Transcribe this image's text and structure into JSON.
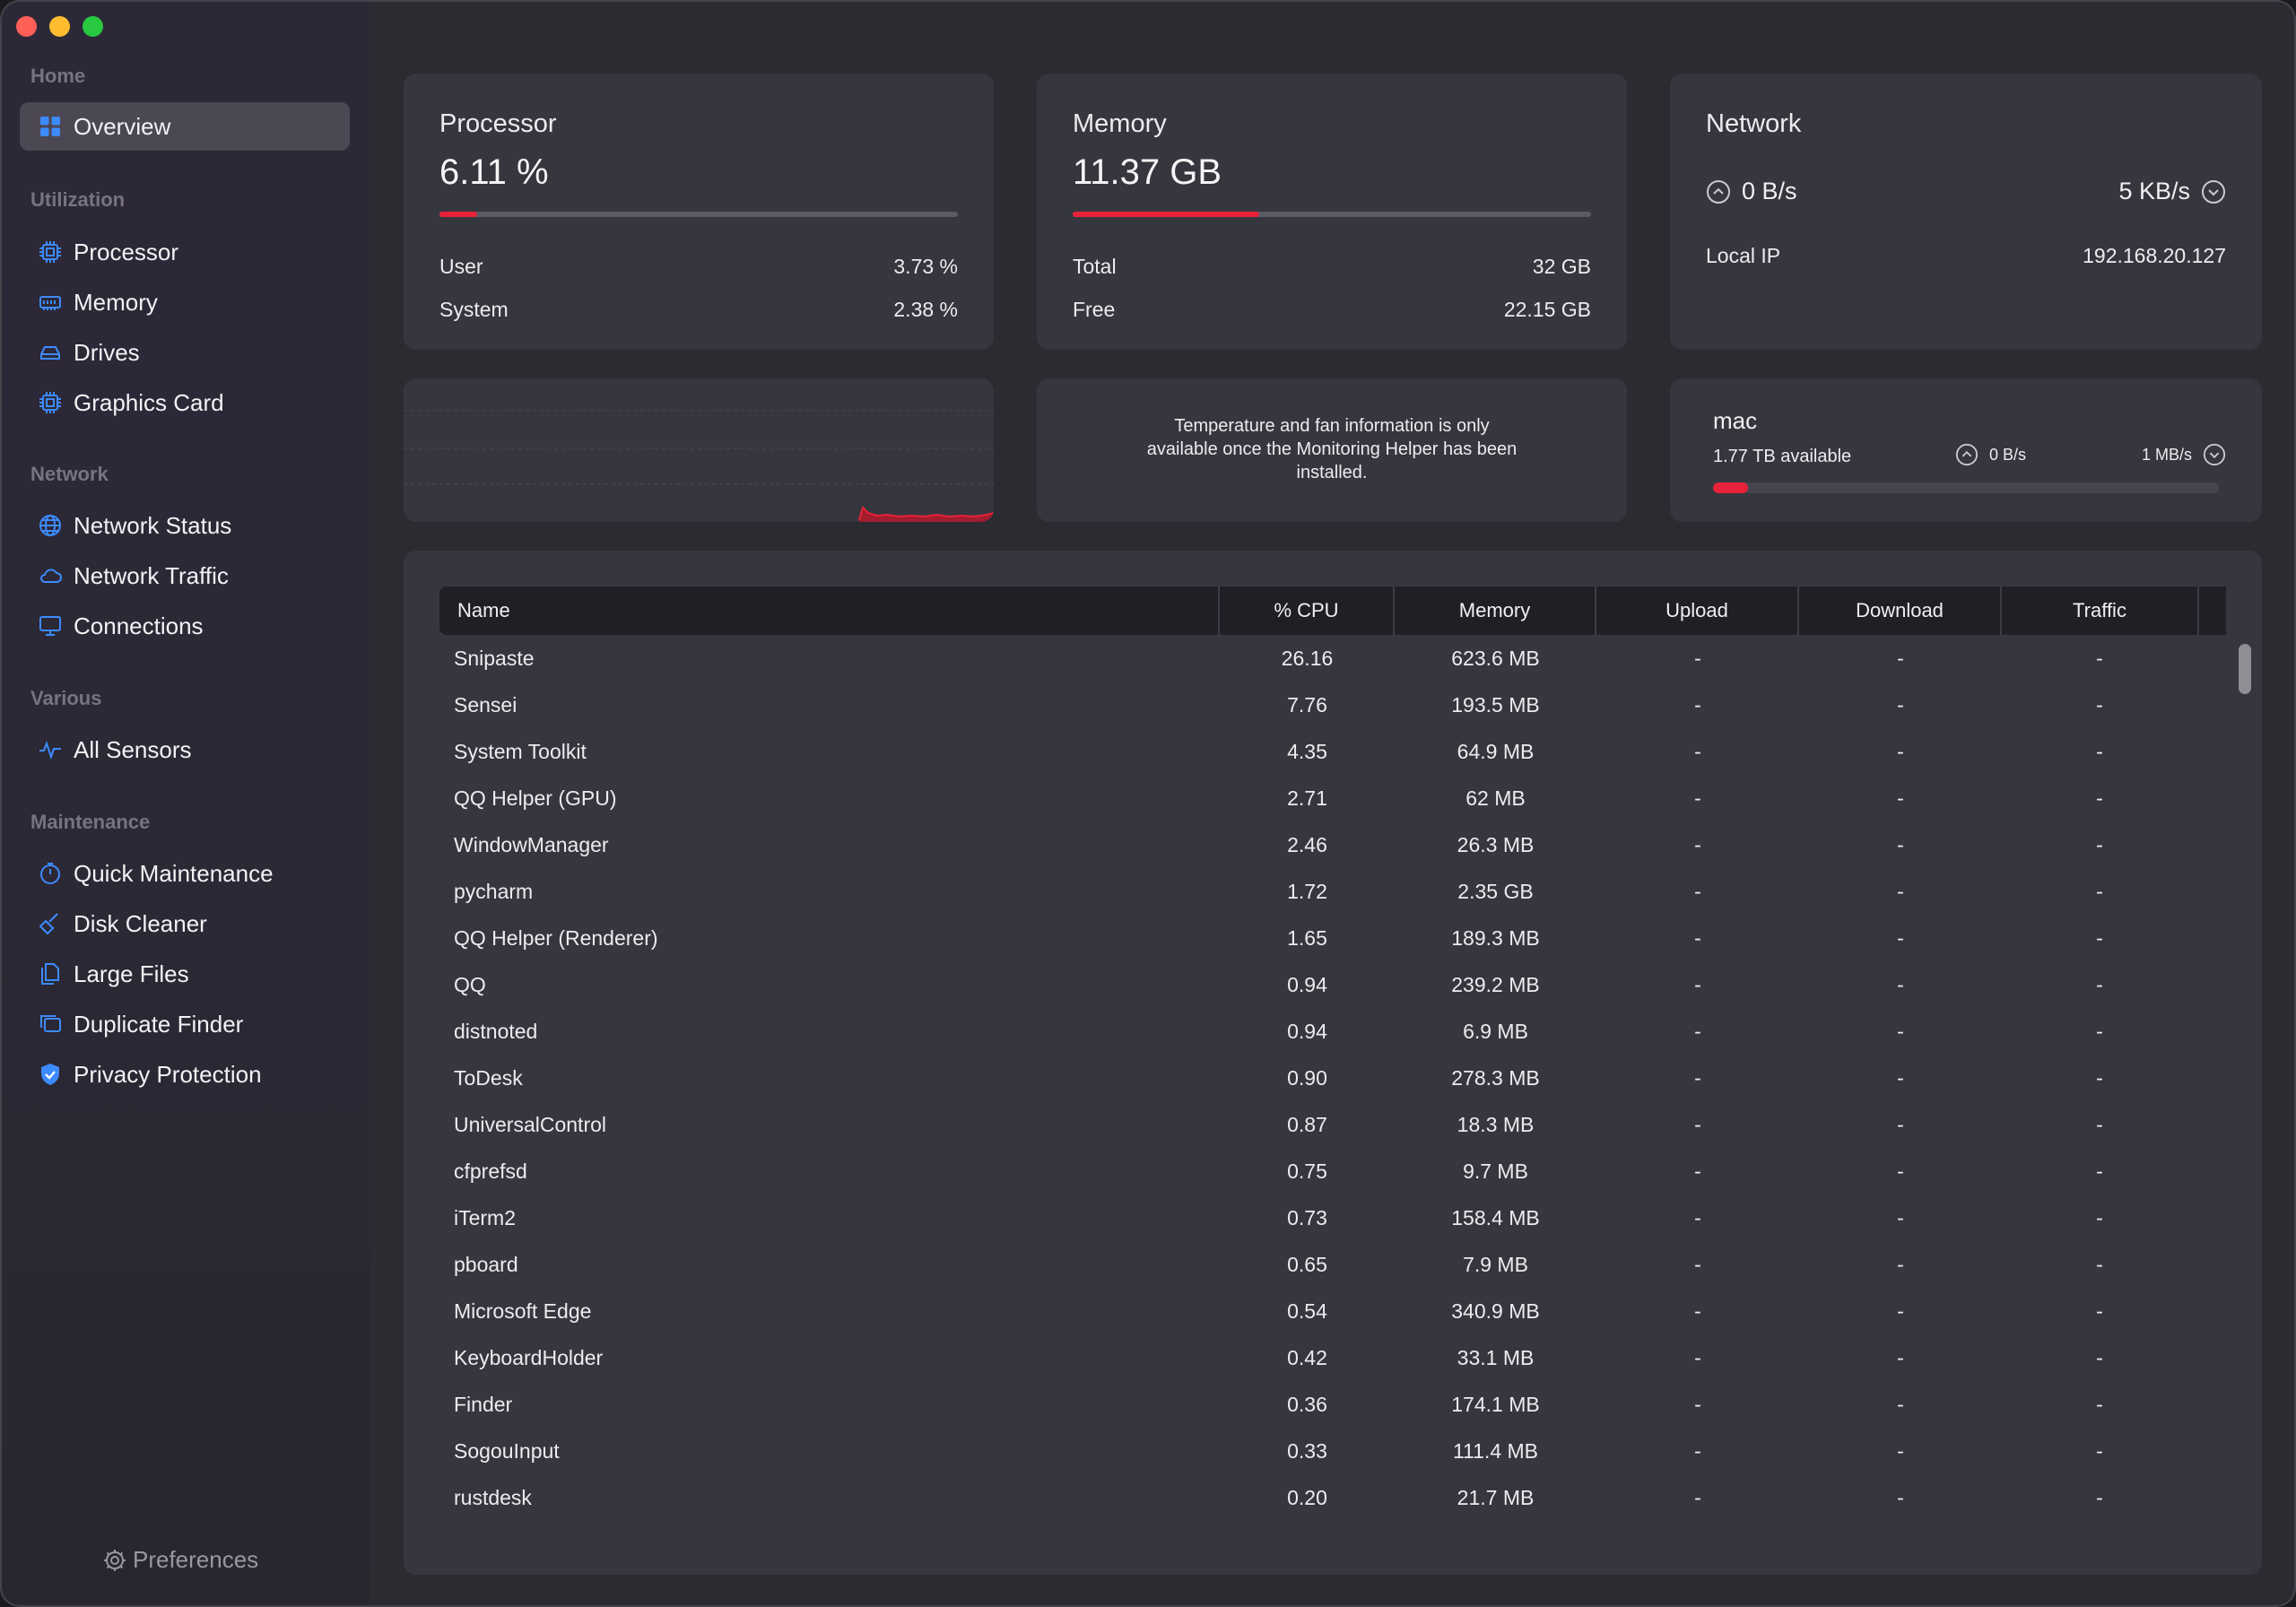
{
  "sidebar": {
    "sections": {
      "home": "Home",
      "utilization": "Utilization",
      "network": "Network",
      "various": "Various",
      "maintenance": "Maintenance"
    },
    "items": {
      "overview": "Overview",
      "processor": "Processor",
      "memory": "Memory",
      "drives": "Drives",
      "graphics": "Graphics Card",
      "network_status": "Network Status",
      "network_traffic": "Network Traffic",
      "connections": "Connections",
      "all_sensors": "All Sensors",
      "quick_maintenance": "Quick Maintenance",
      "disk_cleaner": "Disk Cleaner",
      "large_files": "Large Files",
      "duplicate_finder": "Duplicate Finder",
      "privacy_protection": "Privacy Protection"
    },
    "preferences": "Preferences"
  },
  "processor": {
    "title": "Processor",
    "value": "6.11 %",
    "usage_fraction": 0.0611,
    "user_label": "User",
    "user_value": "3.73 %",
    "system_label": "System",
    "system_value": "2.38 %"
  },
  "memory": {
    "title": "Memory",
    "value": "11.37 GB",
    "usage_fraction": 0.36,
    "total_label": "Total",
    "total_value": "32 GB",
    "free_label": "Free",
    "free_value": "22.15 GB"
  },
  "network": {
    "title": "Network",
    "upload": "0 B/s",
    "download": "5 KB/s",
    "local_ip_label": "Local IP",
    "local_ip": "192.168.20.127"
  },
  "temperature": {
    "message": "Temperature and fan information is only available once the Monitoring Helper has been installed."
  },
  "drive": {
    "name": "mac",
    "available": "1.77 TB available",
    "read": "0 B/s",
    "write": "1 MB/s",
    "used_fraction": 0.07
  },
  "colors": {
    "accent": "#e8223b",
    "icon_blue": "#3d8bff"
  },
  "table": {
    "columns": [
      "Name",
      "% CPU",
      "Memory",
      "Upload",
      "Download",
      "Traffic"
    ],
    "rows": [
      [
        "Snipaste",
        "26.16",
        "623.6 MB",
        "-",
        "-",
        "-"
      ],
      [
        "Sensei",
        "7.76",
        "193.5 MB",
        "-",
        "-",
        "-"
      ],
      [
        "System Toolkit",
        "4.35",
        "64.9 MB",
        "-",
        "-",
        "-"
      ],
      [
        "QQ Helper (GPU)",
        "2.71",
        "62 MB",
        "-",
        "-",
        "-"
      ],
      [
        "WindowManager",
        "2.46",
        "26.3 MB",
        "-",
        "-",
        "-"
      ],
      [
        "pycharm",
        "1.72",
        "2.35 GB",
        "-",
        "-",
        "-"
      ],
      [
        "QQ Helper (Renderer)",
        "1.65",
        "189.3 MB",
        "-",
        "-",
        "-"
      ],
      [
        "QQ",
        "0.94",
        "239.2 MB",
        "-",
        "-",
        "-"
      ],
      [
        "distnoted",
        "0.94",
        "6.9 MB",
        "-",
        "-",
        "-"
      ],
      [
        "ToDesk",
        "0.90",
        "278.3 MB",
        "-",
        "-",
        "-"
      ],
      [
        "UniversalControl",
        "0.87",
        "18.3 MB",
        "-",
        "-",
        "-"
      ],
      [
        "cfprefsd",
        "0.75",
        "9.7 MB",
        "-",
        "-",
        "-"
      ],
      [
        "iTerm2",
        "0.73",
        "158.4 MB",
        "-",
        "-",
        "-"
      ],
      [
        "pboard",
        "0.65",
        "7.9 MB",
        "-",
        "-",
        "-"
      ],
      [
        "Microsoft Edge",
        "0.54",
        "340.9 MB",
        "-",
        "-",
        "-"
      ],
      [
        "KeyboardHolder",
        "0.42",
        "33.1 MB",
        "-",
        "-",
        "-"
      ],
      [
        "Finder",
        "0.36",
        "174.1 MB",
        "-",
        "-",
        "-"
      ],
      [
        "SogouInput",
        "0.33",
        "111.4 MB",
        "-",
        "-",
        "-"
      ],
      [
        "rustdesk",
        "0.20",
        "21.7 MB",
        "-",
        "-",
        "-"
      ]
    ]
  }
}
